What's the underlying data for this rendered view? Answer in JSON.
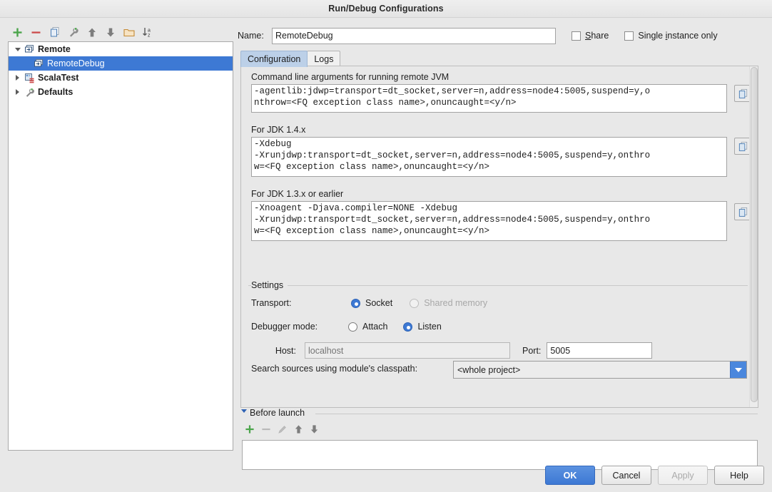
{
  "window": {
    "title": "Run/Debug Configurations"
  },
  "tree_toolbar": [
    {
      "name": "add-configuration-button",
      "icon": "plus-icon",
      "tooltip": "Add New Configuration"
    },
    {
      "name": "remove-configuration-button",
      "icon": "minus-icon",
      "tooltip": "Remove Configuration"
    },
    {
      "name": "copy-configuration-button",
      "icon": "copy-icon",
      "tooltip": "Copy Configuration"
    },
    {
      "name": "edit-defaults-button",
      "icon": "wrench-icon",
      "tooltip": "Edit defaults"
    },
    {
      "name": "move-up-button",
      "icon": "arrow-up-icon",
      "tooltip": "Move Up"
    },
    {
      "name": "move-down-button",
      "icon": "arrow-down-icon",
      "tooltip": "Move Down"
    },
    {
      "name": "create-folder-button",
      "icon": "folder-icon",
      "tooltip": "Create New Folder"
    },
    {
      "name": "sort-button",
      "icon": "sort-alphabetical-icon",
      "tooltip": "Sort Configurations"
    }
  ],
  "tree": {
    "items": [
      {
        "label": "Remote",
        "level": 0,
        "expanded": true,
        "bold": true,
        "selected": false,
        "icon": "remote-icon"
      },
      {
        "label": "RemoteDebug",
        "level": 1,
        "expanded": null,
        "bold": false,
        "selected": true,
        "icon": "remote-icon"
      },
      {
        "label": "ScalaTest",
        "level": 0,
        "expanded": false,
        "bold": true,
        "selected": false,
        "icon": "scalatest-icon"
      },
      {
        "label": "Defaults",
        "level": 0,
        "expanded": false,
        "bold": true,
        "selected": false,
        "icon": "wrench-icon"
      }
    ]
  },
  "header": {
    "name_label": "Name:",
    "name_value": "RemoteDebug",
    "share_label": "Share",
    "share_checked": false,
    "single_instance_label": "Single instance only",
    "single_instance_checked": false
  },
  "tabs": [
    {
      "label": "Configuration",
      "active": true
    },
    {
      "label": "Logs",
      "active": false
    }
  ],
  "fields": {
    "cmdline": {
      "label": "Command line arguments for running remote JVM",
      "value": "-agentlib:jdwp=transport=dt_socket,server=n,address=node4:5005,suspend=y,o\nnthrow=<FQ exception class name>,onuncaught=<y/n>"
    },
    "jdk14": {
      "label": "For JDK 1.4.x",
      "value": "-Xdebug\n-Xrunjdwp:transport=dt_socket,server=n,address=node4:5005,suspend=y,onthro\nw=<FQ exception class name>,onuncaught=<y/n>"
    },
    "jdk13": {
      "label": "For JDK 1.3.x or earlier",
      "value": "-Xnoagent -Djava.compiler=NONE -Xdebug\n-Xrunjdwp:transport=dt_socket,server=n,address=node4:5005,suspend=y,onthro\nw=<FQ exception class name>,onuncaught=<y/n>"
    },
    "copy_button_icon": "copy-to-clipboard-icon"
  },
  "settings": {
    "group_title": "Settings",
    "transport_label": "Transport:",
    "transport_options": [
      {
        "label": "Socket",
        "selected": true,
        "disabled": false
      },
      {
        "label": "Shared memory",
        "selected": false,
        "disabled": true
      }
    ],
    "debugger_mode_label": "Debugger mode:",
    "debugger_mode_options": [
      {
        "label": "Attach",
        "selected": false,
        "disabled": false
      },
      {
        "label": "Listen",
        "selected": true,
        "disabled": false
      }
    ],
    "host_label": "Host:",
    "host_placeholder": "localhost",
    "host_value": "",
    "host_disabled": true,
    "port_label": "Port:",
    "port_value": "5005",
    "classpath_label": "Search sources using module's classpath:",
    "classpath_value": "<whole project>",
    "classpath_options": [
      "<whole project>"
    ]
  },
  "before_launch": {
    "title": "Before launch",
    "expanded": true,
    "toolbar": [
      {
        "name": "add-task-button",
        "icon": "plus-icon",
        "enabled": true
      },
      {
        "name": "remove-task-button",
        "icon": "minus-icon",
        "enabled": false
      },
      {
        "name": "edit-task-button",
        "icon": "pencil-icon",
        "enabled": false
      },
      {
        "name": "task-move-up-button",
        "icon": "arrow-up-icon",
        "enabled": true
      },
      {
        "name": "task-move-down-button",
        "icon": "arrow-down-icon",
        "enabled": true
      }
    ],
    "tasks": []
  },
  "buttons": {
    "ok": "OK",
    "cancel": "Cancel",
    "apply": "Apply",
    "apply_enabled": false,
    "help": "Help"
  },
  "colors": {
    "accent_blue": "#3d79d4",
    "tab_active": "#bcd0e8",
    "dialog_bg": "#e8e8e8",
    "green": "#4ba54b",
    "red": "#cc4b4b",
    "orange": "#d99b3f"
  }
}
